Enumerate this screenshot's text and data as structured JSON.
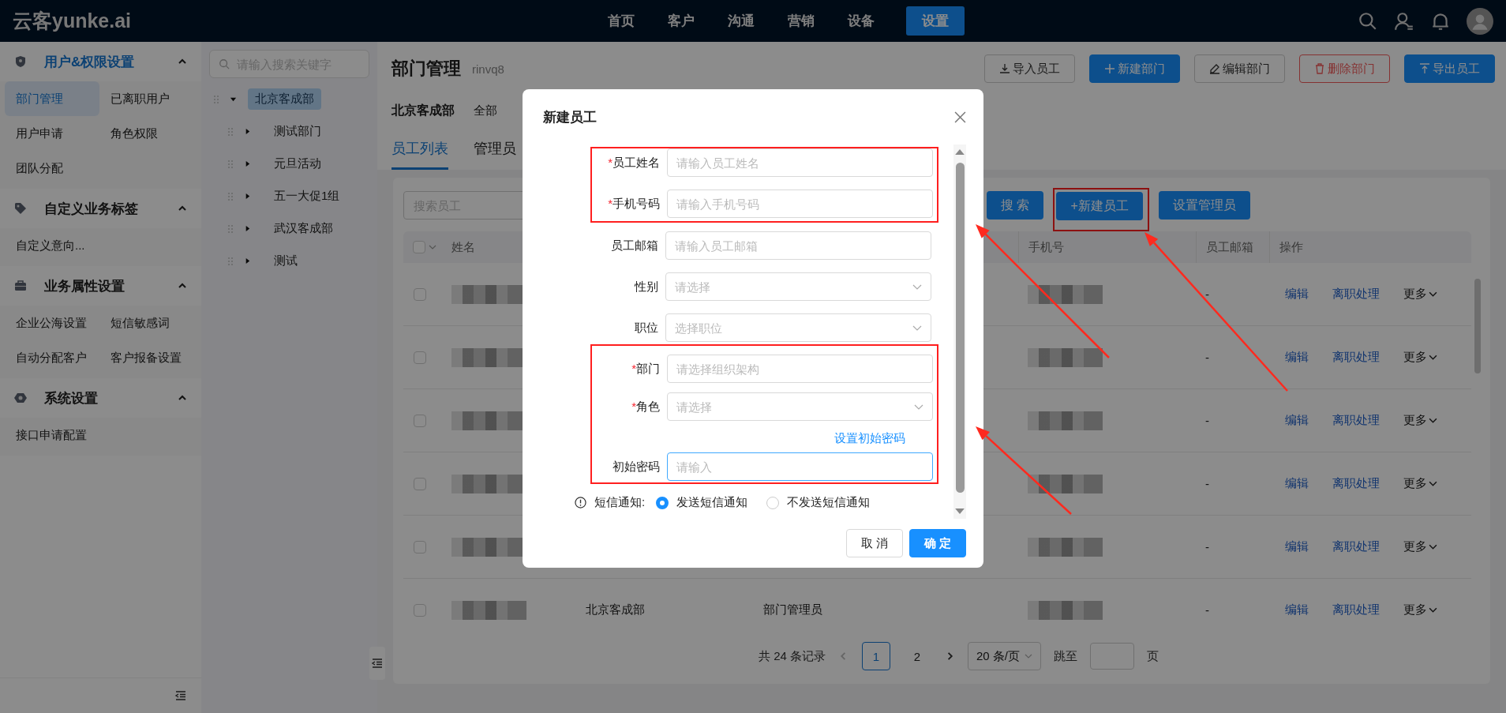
{
  "top_bar": {
    "logo": "云客yunke.ai",
    "nav": [
      {
        "label": "首页",
        "selected": false
      },
      {
        "label": "客户",
        "selected": false
      },
      {
        "label": "沟通",
        "selected": false
      },
      {
        "label": "营销",
        "selected": false
      },
      {
        "label": "设备",
        "selected": false
      },
      {
        "label": "设置",
        "selected": true
      }
    ]
  },
  "sidebar": {
    "sections": [
      {
        "title": "用户&权限设置",
        "active": true,
        "expanded": true,
        "items": [
          {
            "label": "部门管理",
            "selected": true
          },
          {
            "label": "已离职用户",
            "selected": false
          },
          {
            "label": "用户申请",
            "selected": false
          },
          {
            "label": "角色权限",
            "selected": false
          },
          {
            "label": "团队分配",
            "selected": false
          }
        ]
      },
      {
        "title": "自定义业务标签",
        "active": false,
        "expanded": true,
        "items": [
          {
            "label": "自定义意向...",
            "selected": false
          }
        ]
      },
      {
        "title": "业务属性设置",
        "active": false,
        "expanded": true,
        "items": [
          {
            "label": "企业公海设置",
            "selected": false
          },
          {
            "label": "短信敏感词",
            "selected": false
          },
          {
            "label": "自动分配客户",
            "selected": false
          },
          {
            "label": "客户报备设置",
            "selected": false
          }
        ]
      },
      {
        "title": "系统设置",
        "active": false,
        "expanded": true,
        "items": [
          {
            "label": "接口申请配置",
            "selected": false
          }
        ]
      }
    ]
  },
  "tree": {
    "search_placeholder": "请输入搜索关键字",
    "nodes": [
      {
        "label": "北京客成部",
        "selected": true,
        "expanded": true,
        "children": [
          {
            "label": "测试部门",
            "selected": false,
            "expanded": false
          },
          {
            "label": "元旦活动",
            "selected": false,
            "expanded": false
          },
          {
            "label": "五一大促1组",
            "selected": false,
            "expanded": false
          },
          {
            "label": "武汉客成部",
            "selected": false,
            "expanded": false
          },
          {
            "label": "测试",
            "selected": false,
            "expanded": false
          }
        ]
      }
    ]
  },
  "page": {
    "title": "部门管理",
    "subtitle": "rinvq8",
    "actions": [
      {
        "label": "导入员工",
        "kind": "default"
      },
      {
        "label": "新建部门",
        "kind": "primary"
      },
      {
        "label": "编辑部门",
        "kind": "default"
      },
      {
        "label": "删除部门",
        "kind": "danger"
      },
      {
        "label": "导出员工",
        "kind": "primary"
      }
    ],
    "dept_name": "北京客成部",
    "scope": "全部"
  },
  "tabs": [
    {
      "label": "员工列表",
      "selected": true
    },
    {
      "label": "管理员",
      "selected": false
    }
  ],
  "toolbar": {
    "search_placeholder": "搜索员工",
    "buttons": [
      {
        "label": "搜 索",
        "annotated": false
      },
      {
        "label": "+新建员工",
        "annotated": true
      },
      {
        "label": "设置管理员",
        "annotated": false
      }
    ]
  },
  "table": {
    "select_all": {
      "checked": false
    },
    "columns": {
      "name": "姓名",
      "phone": "手机号",
      "email": "员工邮箱",
      "actions": "操作"
    },
    "rows": [
      {
        "checked": false,
        "email": "-",
        "actions": [
          "编辑",
          "离职处理",
          "更多"
        ]
      },
      {
        "checked": false,
        "email": "-",
        "actions": [
          "编辑",
          "离职处理",
          "更多"
        ]
      },
      {
        "checked": false,
        "email": "-",
        "actions": [
          "编辑",
          "离职处理",
          "更多"
        ]
      },
      {
        "checked": false,
        "email": "-",
        "actions": [
          "编辑",
          "离职处理",
          "更多"
        ]
      },
      {
        "checked": false,
        "email": "-",
        "actions": [
          "编辑",
          "离职处理",
          "更多"
        ]
      },
      {
        "checked": false,
        "column_3": "北京客成部",
        "column_4": "部门管理员",
        "email": "-",
        "actions": [
          "编辑",
          "离职处理",
          "更多"
        ]
      }
    ]
  },
  "pagination": {
    "total": "共 24 条记录",
    "pages": [
      {
        "label": "1",
        "selected": true
      },
      {
        "label": "2",
        "selected": false
      }
    ],
    "page_size": "20 条/页",
    "jump_label": "跳至",
    "page_suffix": "页"
  },
  "modal": {
    "title": "新建员工",
    "required_mark": "*",
    "groups": [
      {
        "annotated": true,
        "fields": [
          {
            "kind": "input",
            "label": "员工姓名",
            "required": true,
            "placeholder": "请输入员工姓名",
            "focused": false
          },
          {
            "kind": "input",
            "label": "手机号码",
            "required": true,
            "placeholder": "请输入手机号码",
            "focused": false
          }
        ]
      },
      {
        "annotated": false,
        "fields": [
          {
            "kind": "input",
            "label": "员工邮箱",
            "required": false,
            "placeholder": "请输入员工邮箱",
            "focused": false
          },
          {
            "kind": "select",
            "label": "性别",
            "required": false,
            "placeholder": "请选择",
            "focused": false
          },
          {
            "kind": "select",
            "label": "职位",
            "required": false,
            "placeholder": "选择职位",
            "focused": false
          }
        ]
      },
      {
        "annotated": true,
        "fields": [
          {
            "kind": "input",
            "label": "部门",
            "required": true,
            "placeholder": "请选择组织架构",
            "focused": false
          },
          {
            "kind": "select",
            "label": "角色",
            "required": true,
            "placeholder": "请选择",
            "focused": false
          },
          {
            "kind": "link",
            "label": "设置初始密码"
          },
          {
            "kind": "input",
            "label": "初始密码",
            "required": false,
            "placeholder": "请输入",
            "focused": true
          }
        ]
      }
    ],
    "sms": {
      "label": "短信通知:",
      "options": [
        {
          "label": "发送短信通知",
          "selected": true
        },
        {
          "label": "不发送短信通知",
          "selected": false
        }
      ]
    },
    "buttons": [
      {
        "label": "取 消",
        "kind": "default"
      },
      {
        "label": "确 定",
        "kind": "primary"
      }
    ]
  }
}
